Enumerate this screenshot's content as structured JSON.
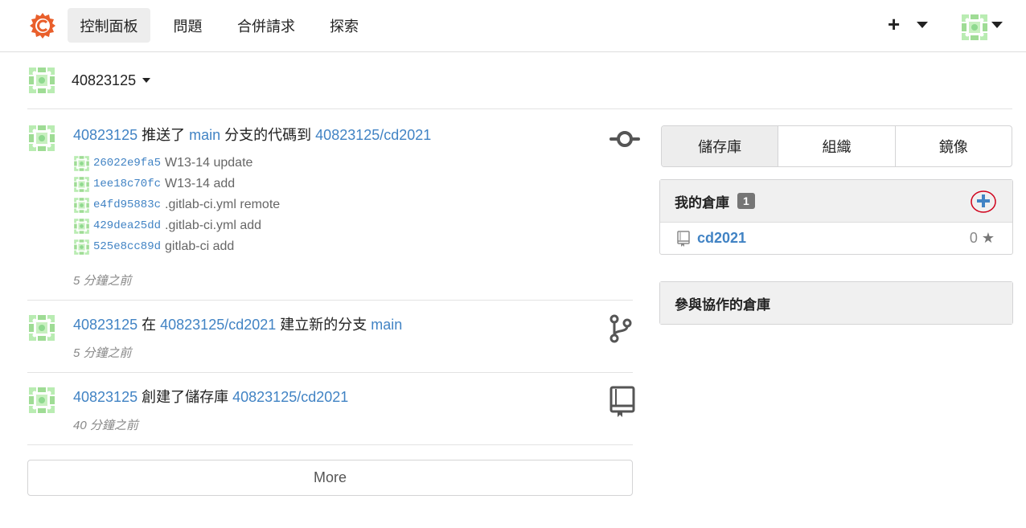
{
  "nav": {
    "dashboard": "控制面板",
    "issues": "問題",
    "pulls": "合併請求",
    "explore": "探索",
    "create_plus": "+"
  },
  "context": {
    "user": "40823125"
  },
  "feed": [
    {
      "user": "40823125",
      "verb": "推送了",
      "branch": "main",
      "mid": "分支的代碼到",
      "repo": "40823125/cd2021",
      "commits": [
        {
          "sha": "26022e9fa5",
          "msg": "W13-14 update"
        },
        {
          "sha": "1ee18c70fc",
          "msg": "W13-14 add"
        },
        {
          "sha": "e4fd95883c",
          "msg": ".gitlab-ci.yml remote"
        },
        {
          "sha": "429dea25dd",
          "msg": ".gitlab-ci.yml add"
        },
        {
          "sha": "525e8cc89d",
          "msg": "gitlab-ci add"
        }
      ],
      "time": "5 分鐘之前",
      "icon": "commit-icon"
    },
    {
      "user": "40823125",
      "pre": "在",
      "repo": "40823125/cd2021",
      "verb": "建立新的分支",
      "branch": "main",
      "time": "5 分鐘之前",
      "icon": "branch-icon"
    },
    {
      "user": "40823125",
      "verb": "創建了儲存庫",
      "repo": "40823125/cd2021",
      "time": "40 分鐘之前",
      "icon": "repo-book-icon"
    }
  ],
  "more_label": "More",
  "side_tabs": [
    "儲存庫",
    "組織",
    "鏡像"
  ],
  "my_repos": {
    "title": "我的倉庫",
    "count": "1",
    "repos": [
      {
        "name": "cd2021",
        "stars": "0"
      }
    ]
  },
  "collab": {
    "title": "參與協作的倉庫"
  },
  "colors": {
    "link": "#4183c4",
    "logo": "#e95f2b",
    "avatar": "#8fd98f",
    "annotation": "#d0021b"
  }
}
